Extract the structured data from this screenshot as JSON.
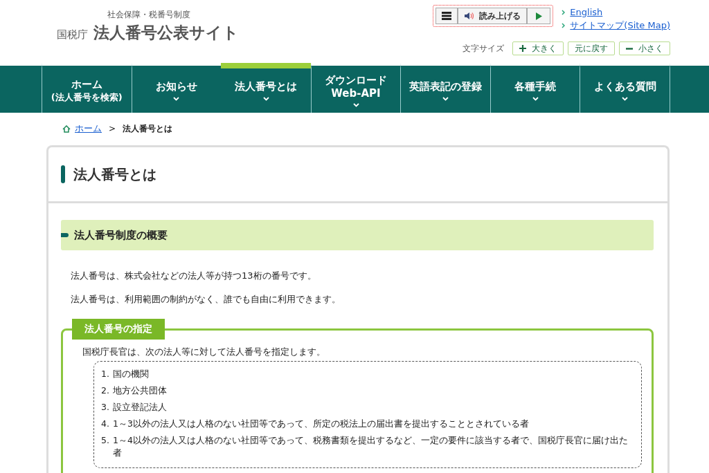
{
  "header": {
    "subtitle": "社会保障・税番号制度",
    "agency": "国税庁",
    "site_title": "法人番号公表サイト",
    "reader": {
      "label": "読み上げる"
    },
    "links": [
      "English",
      "サイトマップ(Site Map)"
    ],
    "font_size": {
      "label": "文字サイズ",
      "buttons": [
        {
          "kind": "plus",
          "label": "大きく"
        },
        {
          "kind": "reset",
          "label": "元に戻す"
        },
        {
          "kind": "minus",
          "label": "小さく"
        }
      ]
    }
  },
  "nav": [
    {
      "lines": [
        "ホーム",
        "(法人番号を検索)"
      ],
      "dropdown": false,
      "selected": false
    },
    {
      "lines": [
        "お知らせ"
      ],
      "dropdown": true,
      "selected": false
    },
    {
      "lines": [
        "法人番号とは"
      ],
      "dropdown": true,
      "selected": true
    },
    {
      "lines": [
        "ダウンロード",
        "Web-API"
      ],
      "dropdown": true,
      "selected": false
    },
    {
      "lines": [
        "英語表記の登録"
      ],
      "dropdown": true,
      "selected": false
    },
    {
      "lines": [
        "各種手続"
      ],
      "dropdown": true,
      "selected": false
    },
    {
      "lines": [
        "よくある質問"
      ],
      "dropdown": true,
      "selected": false
    }
  ],
  "breadcrumb": {
    "home": "ホーム",
    "separator": ">",
    "current": "法人番号とは"
  },
  "page_title": "法人番号とは",
  "section_heading": "法人番号制度の概要",
  "paragraphs": [
    "法人番号は、株式会社などの法人等が持つ13桁の番号です。",
    "法人番号は、利用範囲の制約がなく、誰でも自由に利用できます。"
  ],
  "designation": {
    "label": "法人番号の指定",
    "intro": "国税庁長官は、次の法人等に対して法人番号を指定します。",
    "items": [
      {
        "number": "1.",
        "text": "国の機関"
      },
      {
        "number": "2.",
        "text": "地方公共団体"
      },
      {
        "number": "3.",
        "text": "設立登記法人"
      },
      {
        "number": "4.",
        "text": "1～3以外の法人又は人格のない社団等であって、所定の税法上の届出書を提出することとされている者"
      },
      {
        "number": "5.",
        "text": "1～4以外の法人又は人格のない社団等であって、税務書類を提出するなど、一定の要件に該当する者で、国税庁長官に届け出た者"
      }
    ]
  }
}
